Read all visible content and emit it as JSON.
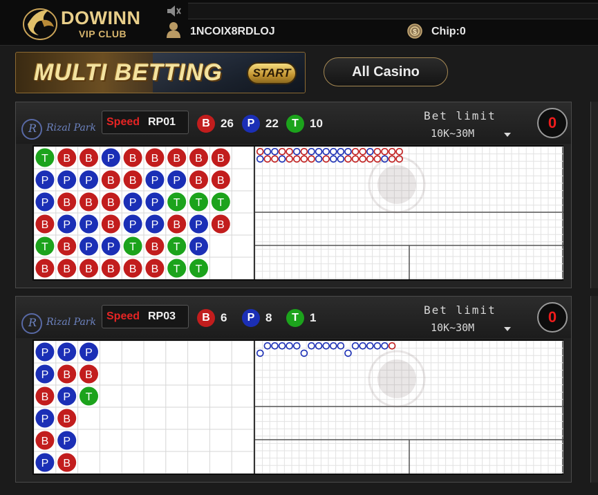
{
  "header": {
    "brand_name": "DOWINN",
    "brand_sub": "VIP CLUB",
    "username": "1NCOIX8RDLOJ",
    "chip_label": "Chip:0",
    "icons": [
      "bird-logo-icon",
      "speaker-mute-icon",
      "user-icon",
      "coin-icon"
    ]
  },
  "banner": {
    "title": "MULTI BETTING",
    "start_label": "START"
  },
  "nav": {
    "all_casino_label": "All Casino"
  },
  "colors": {
    "banker": "#c21d1d",
    "player": "#1b2fb6",
    "tie": "#1ca31c",
    "accent_gold": "#d7b56d"
  },
  "tables": [
    {
      "provider": "Rizal Park",
      "speed_label": "Speed",
      "code": "RP01",
      "banker_label": "B",
      "banker_count": "26",
      "player_label": "P",
      "player_count": "22",
      "tie_label": "T",
      "tie_count": "10",
      "bet_limit_label": "Bet limit",
      "bet_limit_value": "10K~30M",
      "counter": "0",
      "bead_road": [
        [
          "T",
          "B",
          "B",
          "P",
          "B",
          "B",
          "B",
          "B",
          "B"
        ],
        [
          "P",
          "P",
          "P",
          "B",
          "B",
          "P",
          "P",
          "B",
          "B"
        ],
        [
          "P",
          "B",
          "B",
          "B",
          "P",
          "P",
          "T",
          "T",
          "T"
        ],
        [
          "B",
          "P",
          "P",
          "B",
          "P",
          "P",
          "B",
          "P",
          "B"
        ],
        [
          "T",
          "B",
          "P",
          "P",
          "T",
          "B",
          "T",
          "P",
          ""
        ],
        [
          "B",
          "B",
          "B",
          "B",
          "B",
          "B",
          "T",
          "T",
          ""
        ]
      ]
    },
    {
      "provider": "Rizal Park",
      "speed_label": "Speed",
      "code": "RP03",
      "banker_label": "B",
      "banker_count": "6",
      "player_label": "P",
      "player_count": "8",
      "tie_label": "T",
      "tie_count": "1",
      "bet_limit_label": "Bet limit",
      "bet_limit_value": "10K~30M",
      "counter": "0",
      "bead_road": [
        [
          "P",
          "P",
          "P"
        ],
        [
          "P",
          "B",
          "B"
        ],
        [
          "B",
          "P",
          "T"
        ],
        [
          "P",
          "B",
          ""
        ],
        [
          "B",
          "P",
          ""
        ],
        [
          "P",
          "B",
          ""
        ]
      ]
    }
  ]
}
